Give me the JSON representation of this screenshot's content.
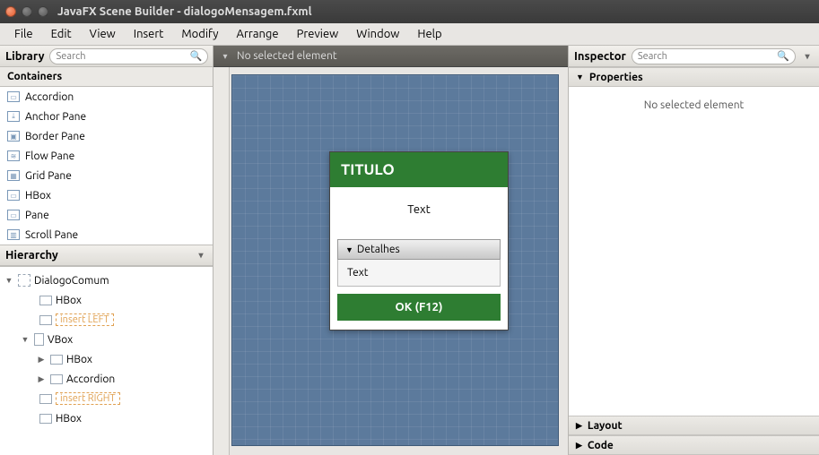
{
  "window": {
    "title": "JavaFX Scene Builder - dialogoMensagem.fxml"
  },
  "menu": {
    "items": [
      "File",
      "Edit",
      "View",
      "Insert",
      "Modify",
      "Arrange",
      "Preview",
      "Window",
      "Help"
    ]
  },
  "library": {
    "title": "Library",
    "search_placeholder": "Search",
    "section": "Containers",
    "items": [
      "Accordion",
      "Anchor Pane",
      "Border Pane",
      "Flow Pane",
      "Grid Pane",
      "HBox",
      "Pane",
      "Scroll Pane"
    ]
  },
  "hierarchy": {
    "title": "Hierarchy",
    "root": "DialogoComum",
    "nodes": {
      "hbox1": "HBox",
      "insert_left": "insert LEFT",
      "vbox": "VBox",
      "hbox2": "HBox",
      "accordion": "Accordion",
      "insert_right": "insert RIGHT",
      "hbox3": "HBox"
    }
  },
  "content": {
    "status": "No selected element"
  },
  "dialog_preview": {
    "title": "TITULO",
    "body_text": "Text",
    "accordion_header": "Detalhes",
    "accordion_text": "Text",
    "ok_label": "OK (F12)"
  },
  "inspector": {
    "title": "Inspector",
    "search_placeholder": "Search",
    "properties": "Properties",
    "empty_msg": "No selected element",
    "layout": "Layout",
    "code": "Code"
  }
}
